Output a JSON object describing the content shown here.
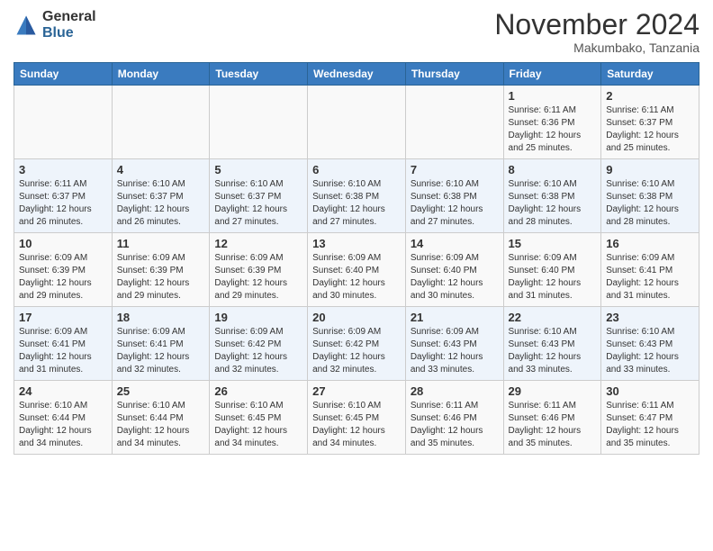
{
  "logo": {
    "general": "General",
    "blue": "Blue"
  },
  "header": {
    "month": "November 2024",
    "location": "Makumbako, Tanzania"
  },
  "weekdays": [
    "Sunday",
    "Monday",
    "Tuesday",
    "Wednesday",
    "Thursday",
    "Friday",
    "Saturday"
  ],
  "weeks": [
    [
      {
        "day": "",
        "info": ""
      },
      {
        "day": "",
        "info": ""
      },
      {
        "day": "",
        "info": ""
      },
      {
        "day": "",
        "info": ""
      },
      {
        "day": "",
        "info": ""
      },
      {
        "day": "1",
        "info": "Sunrise: 6:11 AM\nSunset: 6:36 PM\nDaylight: 12 hours\nand 25 minutes."
      },
      {
        "day": "2",
        "info": "Sunrise: 6:11 AM\nSunset: 6:37 PM\nDaylight: 12 hours\nand 25 minutes."
      }
    ],
    [
      {
        "day": "3",
        "info": "Sunrise: 6:11 AM\nSunset: 6:37 PM\nDaylight: 12 hours\nand 26 minutes."
      },
      {
        "day": "4",
        "info": "Sunrise: 6:10 AM\nSunset: 6:37 PM\nDaylight: 12 hours\nand 26 minutes."
      },
      {
        "day": "5",
        "info": "Sunrise: 6:10 AM\nSunset: 6:37 PM\nDaylight: 12 hours\nand 27 minutes."
      },
      {
        "day": "6",
        "info": "Sunrise: 6:10 AM\nSunset: 6:38 PM\nDaylight: 12 hours\nand 27 minutes."
      },
      {
        "day": "7",
        "info": "Sunrise: 6:10 AM\nSunset: 6:38 PM\nDaylight: 12 hours\nand 27 minutes."
      },
      {
        "day": "8",
        "info": "Sunrise: 6:10 AM\nSunset: 6:38 PM\nDaylight: 12 hours\nand 28 minutes."
      },
      {
        "day": "9",
        "info": "Sunrise: 6:10 AM\nSunset: 6:38 PM\nDaylight: 12 hours\nand 28 minutes."
      }
    ],
    [
      {
        "day": "10",
        "info": "Sunrise: 6:09 AM\nSunset: 6:39 PM\nDaylight: 12 hours\nand 29 minutes."
      },
      {
        "day": "11",
        "info": "Sunrise: 6:09 AM\nSunset: 6:39 PM\nDaylight: 12 hours\nand 29 minutes."
      },
      {
        "day": "12",
        "info": "Sunrise: 6:09 AM\nSunset: 6:39 PM\nDaylight: 12 hours\nand 29 minutes."
      },
      {
        "day": "13",
        "info": "Sunrise: 6:09 AM\nSunset: 6:40 PM\nDaylight: 12 hours\nand 30 minutes."
      },
      {
        "day": "14",
        "info": "Sunrise: 6:09 AM\nSunset: 6:40 PM\nDaylight: 12 hours\nand 30 minutes."
      },
      {
        "day": "15",
        "info": "Sunrise: 6:09 AM\nSunset: 6:40 PM\nDaylight: 12 hours\nand 31 minutes."
      },
      {
        "day": "16",
        "info": "Sunrise: 6:09 AM\nSunset: 6:41 PM\nDaylight: 12 hours\nand 31 minutes."
      }
    ],
    [
      {
        "day": "17",
        "info": "Sunrise: 6:09 AM\nSunset: 6:41 PM\nDaylight: 12 hours\nand 31 minutes."
      },
      {
        "day": "18",
        "info": "Sunrise: 6:09 AM\nSunset: 6:41 PM\nDaylight: 12 hours\nand 32 minutes."
      },
      {
        "day": "19",
        "info": "Sunrise: 6:09 AM\nSunset: 6:42 PM\nDaylight: 12 hours\nand 32 minutes."
      },
      {
        "day": "20",
        "info": "Sunrise: 6:09 AM\nSunset: 6:42 PM\nDaylight: 12 hours\nand 32 minutes."
      },
      {
        "day": "21",
        "info": "Sunrise: 6:09 AM\nSunset: 6:43 PM\nDaylight: 12 hours\nand 33 minutes."
      },
      {
        "day": "22",
        "info": "Sunrise: 6:10 AM\nSunset: 6:43 PM\nDaylight: 12 hours\nand 33 minutes."
      },
      {
        "day": "23",
        "info": "Sunrise: 6:10 AM\nSunset: 6:43 PM\nDaylight: 12 hours\nand 33 minutes."
      }
    ],
    [
      {
        "day": "24",
        "info": "Sunrise: 6:10 AM\nSunset: 6:44 PM\nDaylight: 12 hours\nand 34 minutes."
      },
      {
        "day": "25",
        "info": "Sunrise: 6:10 AM\nSunset: 6:44 PM\nDaylight: 12 hours\nand 34 minutes."
      },
      {
        "day": "26",
        "info": "Sunrise: 6:10 AM\nSunset: 6:45 PM\nDaylight: 12 hours\nand 34 minutes."
      },
      {
        "day": "27",
        "info": "Sunrise: 6:10 AM\nSunset: 6:45 PM\nDaylight: 12 hours\nand 34 minutes."
      },
      {
        "day": "28",
        "info": "Sunrise: 6:11 AM\nSunset: 6:46 PM\nDaylight: 12 hours\nand 35 minutes."
      },
      {
        "day": "29",
        "info": "Sunrise: 6:11 AM\nSunset: 6:46 PM\nDaylight: 12 hours\nand 35 minutes."
      },
      {
        "day": "30",
        "info": "Sunrise: 6:11 AM\nSunset: 6:47 PM\nDaylight: 12 hours\nand 35 minutes."
      }
    ]
  ]
}
